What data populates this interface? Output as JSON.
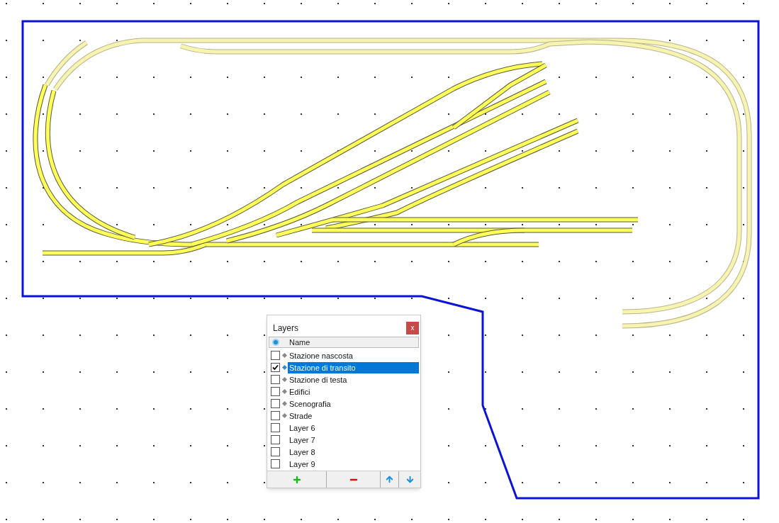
{
  "layers_panel": {
    "title": "Layers",
    "close_label": "x",
    "column_header": "Name",
    "layers": [
      {
        "name": "Stazione nascosta",
        "checked": false,
        "selected": false,
        "kind": "used"
      },
      {
        "name": "Stazione di transito",
        "checked": true,
        "selected": true,
        "kind": "used"
      },
      {
        "name": "Stazione di testa",
        "checked": false,
        "selected": false,
        "kind": "used"
      },
      {
        "name": "Edifici",
        "checked": false,
        "selected": false,
        "kind": "used"
      },
      {
        "name": "Scenografia",
        "checked": false,
        "selected": false,
        "kind": "used"
      },
      {
        "name": "Strade",
        "checked": false,
        "selected": false,
        "kind": "used"
      },
      {
        "name": "Layer 6",
        "checked": false,
        "selected": false,
        "kind": "empty"
      },
      {
        "name": "Layer 7",
        "checked": false,
        "selected": false,
        "kind": "empty"
      },
      {
        "name": "Layer 8",
        "checked": false,
        "selected": false,
        "kind": "empty"
      },
      {
        "name": "Layer 9",
        "checked": false,
        "selected": false,
        "kind": "empty"
      }
    ]
  }
}
